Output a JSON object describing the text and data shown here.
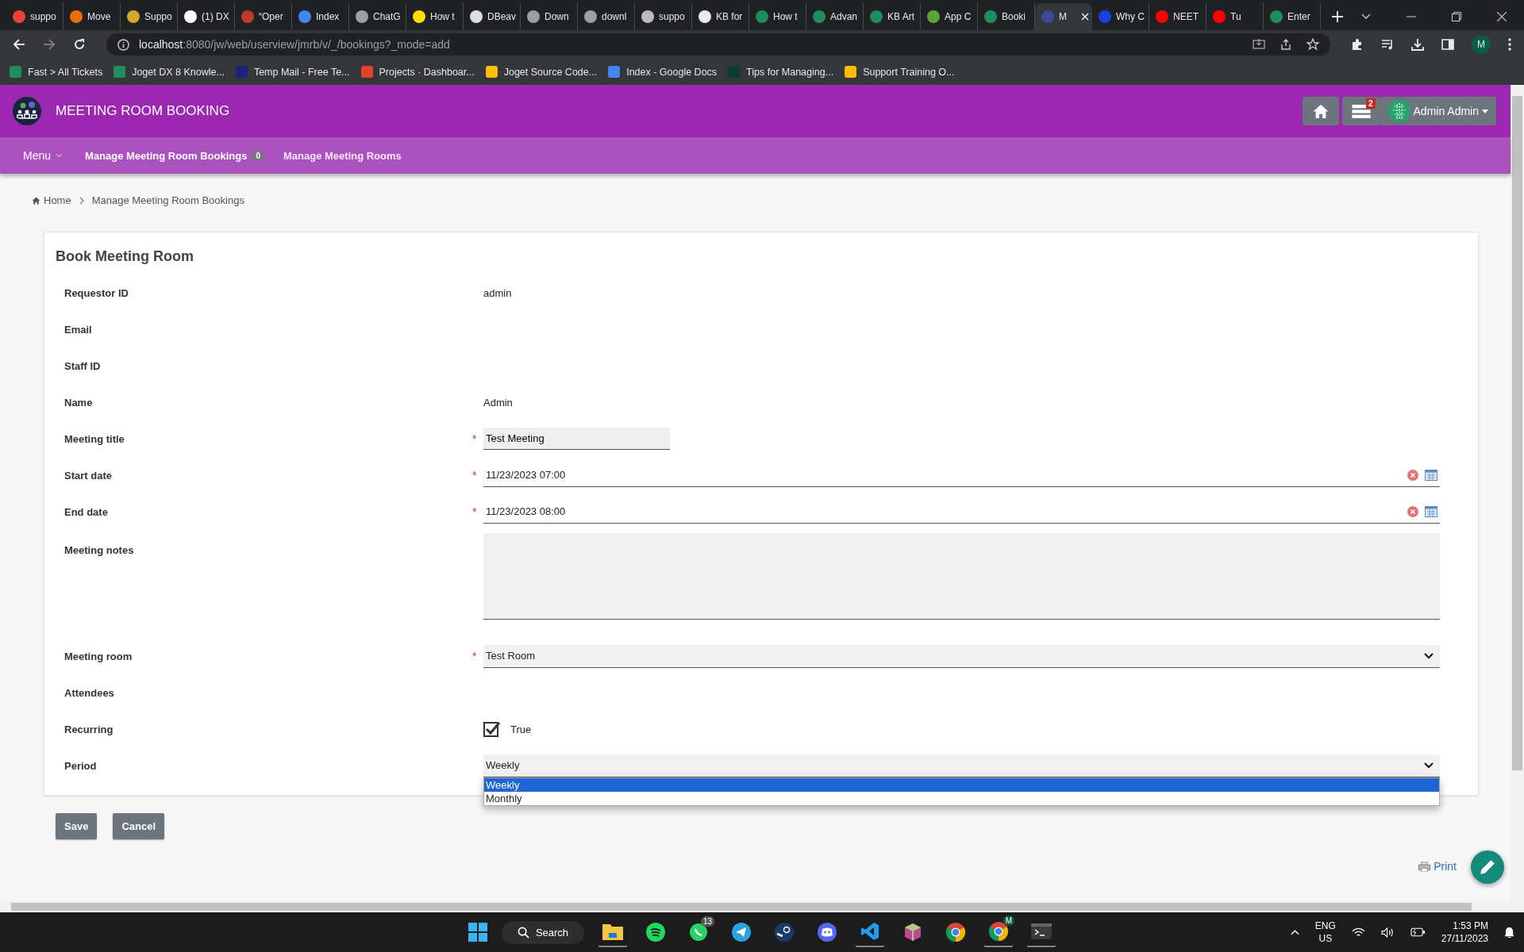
{
  "browser": {
    "tabs": [
      {
        "title": "suppo",
        "color": "#ea4335",
        "selected": false
      },
      {
        "title": "Move",
        "color": "#e8710a",
        "selected": false
      },
      {
        "title": "Suppo",
        "color": "#d4a72c",
        "selected": false
      },
      {
        "title": "(1) DX",
        "color": "#ffffff",
        "selected": false
      },
      {
        "title": "“Oper",
        "color": "#c0392b",
        "selected": false
      },
      {
        "title": "Index",
        "color": "#4285f4",
        "selected": false
      },
      {
        "title": "ChatG",
        "color": "#9aa0a6",
        "selected": false
      },
      {
        "title": "How t",
        "color": "#f9e000",
        "selected": false
      },
      {
        "title": "DBeav",
        "color": "#dddddd",
        "selected": false
      },
      {
        "title": "Down",
        "color": "#9aa0a6",
        "selected": false
      },
      {
        "title": "downl",
        "color": "#9aa0a6",
        "selected": false
      },
      {
        "title": "suppo",
        "color": "#bbbbbb",
        "selected": false
      },
      {
        "title": "KB for",
        "color": "#e8eaed",
        "selected": false
      },
      {
        "title": "How t",
        "color": "#1e8e5e",
        "selected": false
      },
      {
        "title": "Advan",
        "color": "#1e8e5e",
        "selected": false
      },
      {
        "title": "KB Art",
        "color": "#1e8e5e",
        "selected": false
      },
      {
        "title": "App C",
        "color": "#5aa53b",
        "selected": false
      },
      {
        "title": "Booki",
        "color": "#1e8e5e",
        "selected": false
      },
      {
        "title": "M",
        "color": "#3b4b9b",
        "selected": true
      },
      {
        "title": "Why C",
        "color": "#1a3fe0",
        "selected": false
      },
      {
        "title": "NEET",
        "color": "#ff0000",
        "selected": false
      },
      {
        "title": "Tu",
        "color": "#ff0000",
        "selected": false
      },
      {
        "title": "Enter",
        "color": "#1e8e5e",
        "selected": false
      }
    ],
    "address": {
      "host": "localhost",
      "rest": ":8080/jw/web/userview/jmrb/v/_/bookings?_mode=add"
    },
    "profile": "M",
    "bookmarks": [
      {
        "title": "Fast > All Tickets",
        "color": "#1e8e5e"
      },
      {
        "title": "Joget DX 8 Knowle...",
        "color": "#1e8e5e"
      },
      {
        "title": "Temp Mail - Free Te...",
        "color": "#1a237e"
      },
      {
        "title": "Projects · Dashboar...",
        "color": "#e24329"
      },
      {
        "title": "Joget Source Code...",
        "color": "#fbbc04"
      },
      {
        "title": "Index - Google Docs",
        "color": "#4285f4"
      },
      {
        "title": "Tips for Managing...",
        "color": "#0b3d2e"
      },
      {
        "title": "Support Training O...",
        "color": "#fbbc04"
      }
    ]
  },
  "app": {
    "title": "MEETING ROOM BOOKING",
    "notification_count": "2",
    "user": "Admin Admin",
    "nav": [
      {
        "label": "Menu",
        "kind": "menu"
      },
      {
        "label": "Manage Meeting Room Bookings",
        "kind": "link",
        "badge": "0",
        "selected": true
      },
      {
        "label": "Manage Meeting Rooms",
        "kind": "link",
        "selected": false
      }
    ],
    "breadcrumb": [
      "Home",
      "Manage Meeting Room Bookings"
    ],
    "form": {
      "title": "Book Meeting Room",
      "fields": [
        {
          "label": "Requestor ID",
          "kind": "static",
          "value": "admin"
        },
        {
          "label": "Email",
          "kind": "static"
        },
        {
          "label": "Staff ID",
          "kind": "static"
        },
        {
          "label": "Name",
          "kind": "static",
          "value": "Admin"
        },
        {
          "label": "Meeting title",
          "kind": "text",
          "marker": "*",
          "value": "Test Meeting"
        },
        {
          "label": "Start date",
          "kind": "date",
          "marker": "*",
          "value": "11/23/2023 07:00"
        },
        {
          "label": "End date",
          "kind": "date",
          "marker": "*",
          "value": "11/23/2023 08:00"
        },
        {
          "label": "Meeting notes",
          "kind": "textarea"
        },
        {
          "label": "Meeting room",
          "kind": "select",
          "marker": "*",
          "value": "Test Room"
        },
        {
          "label": "Attendees",
          "kind": "static"
        },
        {
          "label": "Recurring",
          "kind": "checkbox",
          "checked": true,
          "value": "True"
        },
        {
          "label": "Period",
          "kind": "select",
          "value": "Weekly",
          "open": true,
          "options": [
            {
              "label": "Weekly",
              "selected": true
            },
            {
              "label": "Monthly",
              "selected": false
            }
          ]
        }
      ]
    },
    "buttons": [
      "Save",
      "Cancel"
    ],
    "print": "Print"
  },
  "taskbar": {
    "search": "Search",
    "apps": [
      {
        "kind": "files",
        "running": true
      },
      {
        "kind": "spotify",
        "running": false
      },
      {
        "kind": "whatsapp",
        "running": false,
        "badge": "13"
      },
      {
        "kind": "telegram",
        "running": false
      },
      {
        "kind": "steam",
        "running": false
      },
      {
        "kind": "discord",
        "running": false
      },
      {
        "kind": "vscode",
        "running": true
      },
      {
        "kind": "box",
        "running": false
      },
      {
        "kind": "chrome",
        "running": false
      },
      {
        "kind": "chrome-profile",
        "running": true,
        "badge": "M"
      },
      {
        "kind": "terminal",
        "running": true
      }
    ],
    "language": "ENG",
    "region": "US",
    "time": "1:53 PM",
    "date": "27/11/2023"
  }
}
